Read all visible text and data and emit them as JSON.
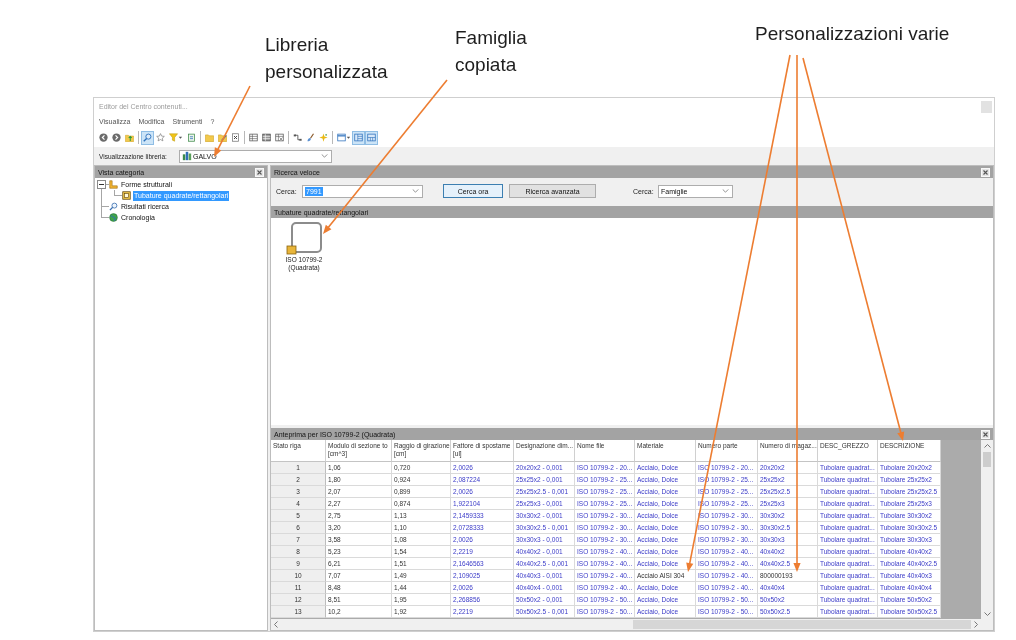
{
  "annotations": [
    {
      "text": "Libreria personalizzata"
    },
    {
      "text": "Famiglia copiata"
    },
    {
      "text": "Personalizzazioni varie"
    }
  ],
  "window": {
    "title": "Editor del Centro contenuti..."
  },
  "menu": [
    "Visualizza",
    "Modifica",
    "Strumenti",
    "?"
  ],
  "toolbar": [
    [
      {
        "pressed": false
      },
      {
        "pressed": false
      },
      {
        "pressed": false
      }
    ],
    [
      {
        "pressed": true
      },
      {
        "pressed": false
      },
      {
        "pressed": false
      },
      {
        "pressed": false
      }
    ],
    [
      {
        "pressed": false
      },
      {
        "pressed": false
      },
      {
        "pressed": false
      }
    ],
    [
      {
        "pressed": false
      },
      {
        "pressed": false
      },
      {
        "pressed": false
      }
    ],
    [
      {
        "pressed": false
      },
      {
        "pressed": false
      },
      {
        "pressed": false
      }
    ],
    [
      {
        "pressed": false
      },
      {
        "pressed": true
      },
      {
        "pressed": true
      }
    ]
  ],
  "library": {
    "label": "Visualizzazione libreria:",
    "value": "GALVO"
  },
  "category_panel": {
    "title": "Vista categoria",
    "tree": [
      {
        "label": "Forme strutturali",
        "selected": false,
        "expanded": true,
        "children": [
          {
            "label": "Tubature quadrate/rettangolari",
            "selected": true
          }
        ]
      },
      {
        "label": "Risultati ricerca",
        "selected": false
      },
      {
        "label": "Cronologia",
        "selected": false
      }
    ]
  },
  "quick_search": {
    "title": "Ricerca veloce",
    "search_label": "Cerca:",
    "search_value": "7991",
    "value_selected": true,
    "buttons": [
      {
        "label": "Cerca ora",
        "focused": true
      },
      {
        "label": "Ricerca avanzata",
        "focused": false
      }
    ],
    "scope_label": "Cerca:",
    "scope_value": "Famiglie"
  },
  "results": {
    "title": "Tubature quadrate/rettangolari",
    "items": [
      {
        "label": "ISO 10799-2 (Quadrata)"
      }
    ]
  },
  "preview": {
    "title": "Anteprima per ISO 10799-2 (Quadrata)",
    "columns": [
      {
        "label": "Stato riga"
      },
      {
        "label": "Modulo di sezione to",
        "unit": "[cm^3]"
      },
      {
        "label": "Raggio di girazione",
        "unit": "[cm]"
      },
      {
        "label": "Fattore di spostame",
        "unit": "[ul]"
      },
      {
        "label": "Designazione dim..."
      },
      {
        "label": "Nome file"
      },
      {
        "label": "Materiale"
      },
      {
        "label": "Numero parte"
      },
      {
        "label": "Numero di magaz..."
      },
      {
        "label": "DESC_GREZZO"
      },
      {
        "label": "DESCRIZIONE"
      }
    ],
    "rows": [
      {
        "cells": [
          {
            "text": "1",
            "computed": false
          },
          {
            "text": "1,06",
            "computed": false
          },
          {
            "text": "0,720",
            "computed": false
          },
          {
            "text": "2,0026",
            "computed": true
          },
          {
            "text": "20x20x2 - 0,001",
            "computed": true
          },
          {
            "text": "ISO 10799-2 - 20...",
            "computed": true
          },
          {
            "text": "Acciaio, Dolce",
            "computed": true
          },
          {
            "text": "ISO 10799-2 - 20...",
            "computed": true
          },
          {
            "text": "20x20x2",
            "computed": true
          },
          {
            "text": "Tubolare quadrat...",
            "computed": true
          },
          {
            "text": "Tubolare 20x20x2",
            "computed": true
          }
        ]
      },
      {
        "cells": [
          {
            "text": "2",
            "computed": false
          },
          {
            "text": "1,80",
            "computed": false
          },
          {
            "text": "0,924",
            "computed": false
          },
          {
            "text": "2,087224",
            "computed": true
          },
          {
            "text": "25x25x2 - 0,001",
            "computed": true
          },
          {
            "text": "ISO 10799-2 - 25...",
            "computed": true
          },
          {
            "text": "Acciaio, Dolce",
            "computed": true
          },
          {
            "text": "ISO 10799-2 - 25...",
            "computed": true
          },
          {
            "text": "25x25x2",
            "computed": true
          },
          {
            "text": "Tubolare quadrat...",
            "computed": true
          },
          {
            "text": "Tubolare 25x25x2",
            "computed": true
          }
        ]
      },
      {
        "cells": [
          {
            "text": "3",
            "computed": false
          },
          {
            "text": "2,07",
            "computed": false
          },
          {
            "text": "0,899",
            "computed": false
          },
          {
            "text": "2,0026",
            "computed": true
          },
          {
            "text": "25x25x2.5 - 0,001",
            "computed": true
          },
          {
            "text": "ISO 10799-2 - 25...",
            "computed": true
          },
          {
            "text": "Acciaio, Dolce",
            "computed": true
          },
          {
            "text": "ISO 10799-2 - 25...",
            "computed": true
          },
          {
            "text": "25x25x2.5",
            "computed": true
          },
          {
            "text": "Tubolare quadrat...",
            "computed": true
          },
          {
            "text": "Tubolare 25x25x2.5",
            "computed": true
          }
        ]
      },
      {
        "cells": [
          {
            "text": "4",
            "computed": false
          },
          {
            "text": "2,27",
            "computed": false
          },
          {
            "text": "0,874",
            "computed": false
          },
          {
            "text": "1,922104",
            "computed": true
          },
          {
            "text": "25x25x3 - 0,001",
            "computed": true
          },
          {
            "text": "ISO 10799-2 - 25...",
            "computed": true
          },
          {
            "text": "Acciaio, Dolce",
            "computed": true
          },
          {
            "text": "ISO 10799-2 - 25...",
            "computed": true
          },
          {
            "text": "25x25x3",
            "computed": true
          },
          {
            "text": "Tubolare quadrat...",
            "computed": true
          },
          {
            "text": "Tubolare 25x25x3",
            "computed": true
          }
        ]
      },
      {
        "cells": [
          {
            "text": "5",
            "computed": false
          },
          {
            "text": "2,75",
            "computed": false
          },
          {
            "text": "1,13",
            "computed": false
          },
          {
            "text": "2,1459333",
            "computed": true
          },
          {
            "text": "30x30x2 - 0,001",
            "computed": true
          },
          {
            "text": "ISO 10799-2 - 30...",
            "computed": true
          },
          {
            "text": "Acciaio, Dolce",
            "computed": true
          },
          {
            "text": "ISO 10799-2 - 30...",
            "computed": true
          },
          {
            "text": "30x30x2",
            "computed": true
          },
          {
            "text": "Tubolare quadrat...",
            "computed": true
          },
          {
            "text": "Tubolare 30x30x2",
            "computed": true
          }
        ]
      },
      {
        "cells": [
          {
            "text": "6",
            "computed": false
          },
          {
            "text": "3,20",
            "computed": false
          },
          {
            "text": "1,10",
            "computed": false
          },
          {
            "text": "2,0728333",
            "computed": true
          },
          {
            "text": "30x30x2.5 - 0,001",
            "computed": true
          },
          {
            "text": "ISO 10799-2 - 30...",
            "computed": true
          },
          {
            "text": "Acciaio, Dolce",
            "computed": true
          },
          {
            "text": "ISO 10799-2 - 30...",
            "computed": true
          },
          {
            "text": "30x30x2.5",
            "computed": true
          },
          {
            "text": "Tubolare quadrat...",
            "computed": true
          },
          {
            "text": "Tubolare 30x30x2.5",
            "computed": true
          }
        ]
      },
      {
        "cells": [
          {
            "text": "7",
            "computed": false
          },
          {
            "text": "3,58",
            "computed": false
          },
          {
            "text": "1,08",
            "computed": false
          },
          {
            "text": "2,0026",
            "computed": true
          },
          {
            "text": "30x30x3 - 0,001",
            "computed": true
          },
          {
            "text": "ISO 10799-2 - 30...",
            "computed": true
          },
          {
            "text": "Acciaio, Dolce",
            "computed": true
          },
          {
            "text": "ISO 10799-2 - 30...",
            "computed": true
          },
          {
            "text": "30x30x3",
            "computed": true
          },
          {
            "text": "Tubolare quadrat...",
            "computed": true
          },
          {
            "text": "Tubolare 30x30x3",
            "computed": true
          }
        ]
      },
      {
        "cells": [
          {
            "text": "8",
            "computed": false
          },
          {
            "text": "5,23",
            "computed": false
          },
          {
            "text": "1,54",
            "computed": false
          },
          {
            "text": "2,2219",
            "computed": true
          },
          {
            "text": "40x40x2 - 0,001",
            "computed": true
          },
          {
            "text": "ISO 10799-2 - 40...",
            "computed": true
          },
          {
            "text": "Acciaio, Dolce",
            "computed": true
          },
          {
            "text": "ISO 10799-2 - 40...",
            "computed": true
          },
          {
            "text": "40x40x2",
            "computed": true
          },
          {
            "text": "Tubolare quadrat...",
            "computed": true
          },
          {
            "text": "Tubolare 40x40x2",
            "computed": true
          }
        ]
      },
      {
        "cells": [
          {
            "text": "9",
            "computed": false
          },
          {
            "text": "6,21",
            "computed": false
          },
          {
            "text": "1,51",
            "computed": false
          },
          {
            "text": "2,1646563",
            "computed": true
          },
          {
            "text": "40x40x2.5 - 0,001",
            "computed": true
          },
          {
            "text": "ISO 10799-2 - 40...",
            "computed": true
          },
          {
            "text": "Acciaio, Dolce",
            "computed": true
          },
          {
            "text": "ISO 10799-2 - 40...",
            "computed": true
          },
          {
            "text": "40x40x2.5",
            "computed": true
          },
          {
            "text": "Tubolare quadrat...",
            "computed": true
          },
          {
            "text": "Tubolare 40x40x2.5",
            "computed": true
          }
        ]
      },
      {
        "cells": [
          {
            "text": "10",
            "computed": false
          },
          {
            "text": "7,07",
            "computed": false
          },
          {
            "text": "1,49",
            "computed": false
          },
          {
            "text": "2,109025",
            "computed": true
          },
          {
            "text": "40x40x3 - 0,001",
            "computed": true
          },
          {
            "text": "ISO 10799-2 - 40...",
            "computed": true
          },
          {
            "text": "Acciaio AISI 304",
            "computed": false
          },
          {
            "text": "ISO 10799-2 - 40...",
            "computed": true
          },
          {
            "text": "800000193",
            "computed": false
          },
          {
            "text": "Tubolare quadrat...",
            "computed": true
          },
          {
            "text": "Tubolare 40x40x3",
            "computed": true
          }
        ]
      },
      {
        "cells": [
          {
            "text": "11",
            "computed": false
          },
          {
            "text": "8,48",
            "computed": false
          },
          {
            "text": "1,44",
            "computed": false
          },
          {
            "text": "2,0026",
            "computed": true
          },
          {
            "text": "40x40x4 - 0,001",
            "computed": true
          },
          {
            "text": "ISO 10799-2 - 40...",
            "computed": true
          },
          {
            "text": "Acciaio, Dolce",
            "computed": true
          },
          {
            "text": "ISO 10799-2 - 40...",
            "computed": true
          },
          {
            "text": "40x40x4",
            "computed": true
          },
          {
            "text": "Tubolare quadrat...",
            "computed": true
          },
          {
            "text": "Tubolare 40x40x4",
            "computed": true
          }
        ]
      },
      {
        "cells": [
          {
            "text": "12",
            "computed": false
          },
          {
            "text": "8,51",
            "computed": false
          },
          {
            "text": "1,95",
            "computed": false
          },
          {
            "text": "2,268856",
            "computed": true
          },
          {
            "text": "50x50x2 - 0,001",
            "computed": true
          },
          {
            "text": "ISO 10799-2 - 50...",
            "computed": true
          },
          {
            "text": "Acciaio, Dolce",
            "computed": true
          },
          {
            "text": "ISO 10799-2 - 50...",
            "computed": true
          },
          {
            "text": "50x50x2",
            "computed": true
          },
          {
            "text": "Tubolare quadrat...",
            "computed": true
          },
          {
            "text": "Tubolare 50x50x2",
            "computed": true
          }
        ]
      },
      {
        "cells": [
          {
            "text": "13",
            "computed": false
          },
          {
            "text": "10,2",
            "computed": false
          },
          {
            "text": "1,92",
            "computed": false
          },
          {
            "text": "2,2219",
            "computed": true
          },
          {
            "text": "50x50x2.5 - 0,001",
            "computed": true
          },
          {
            "text": "ISO 10799-2 - 50...",
            "computed": true
          },
          {
            "text": "Acciaio, Dolce",
            "computed": true
          },
          {
            "text": "ISO 10799-2 - 50...",
            "computed": true
          },
          {
            "text": "50x50x2.5",
            "computed": true
          },
          {
            "text": "Tubolare quadrat...",
            "computed": true
          },
          {
            "text": "Tubolare 50x50x2.5",
            "computed": true
          }
        ]
      }
    ]
  }
}
